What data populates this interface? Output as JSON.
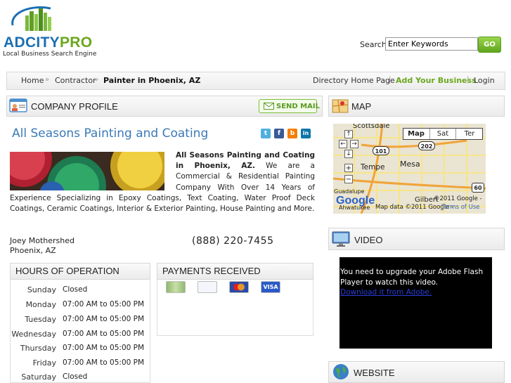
{
  "header": {
    "logo_text": "ADCITYPRO",
    "logo_tagline": "Local Business Search Engine",
    "search_label": "Search",
    "search_placeholder": "Enter Keywords",
    "search_value": "Enter Keywords",
    "go_label": "GO"
  },
  "breadcrumb": {
    "home": "Home",
    "sep": "»",
    "contractor": "Contractor",
    "current": "Painter in Phoenix, AZ",
    "directory_home": "Directory Home Page",
    "add_business": "Add Your Business",
    "login": "Login",
    "pipe": "|"
  },
  "profile": {
    "title": "COMPANY PROFILE",
    "send_mail": "SEND MAIL",
    "business_name": "All Seasons Painting and Coating",
    "social": [
      "t",
      "f",
      "b",
      "in"
    ],
    "desc_bold": "All Seasons Painting and Coating in Phoenix, AZ.",
    "desc_rest": " We are a Commercial & Residential Painting Company With Over 14 Years of Experience Specializing in Epoxy Coatings, Text Coating, Water Proof Deck Coatings, Ceramic Coatings, Interior & Exterior Painting, House Painting and More.",
    "contact_name": "Joey Mothershed",
    "contact_city": "Phoenix, AZ",
    "phone": "(888) 220-7455"
  },
  "hours": {
    "title": "HOURS OF OPERATION",
    "days": [
      {
        "day": "Sunday",
        "time": "Closed"
      },
      {
        "day": "Monday",
        "time": "07:00 AM to 05:00 PM"
      },
      {
        "day": "Tuesday",
        "time": "07:00 AM to 05:00 PM"
      },
      {
        "day": "Wednesday",
        "time": "07:00 AM to 05:00 PM"
      },
      {
        "day": "Thursday",
        "time": "07:00 AM to 05:00 PM"
      },
      {
        "day": "Friday",
        "time": "07:00 AM to 05:00 PM"
      },
      {
        "day": "Saturday",
        "time": "Closed"
      }
    ]
  },
  "payments": {
    "title": "PAYMENTS RECEIVED",
    "cards": [
      "cash-icon",
      "check-icon",
      "mastercard-icon",
      "visa-icon"
    ],
    "visa_label": "VISA"
  },
  "map": {
    "title": "MAP",
    "types": [
      "Map",
      "Sat",
      "Ter"
    ],
    "labels": {
      "scottsdale": "Scottsdale",
      "tempe": "Tempe",
      "mesa": "Mesa",
      "gilbert": "Gilbert",
      "guadalupe": "Guadalupe",
      "ahwatukee": "Ahwatukee",
      "r101": "101",
      "r202": "202",
      "r60": "60"
    },
    "copyright1": "©2011 Google -",
    "copyright2": "Map data ©2011 Google -",
    "terms": "Terms of Use",
    "google": "Google"
  },
  "video": {
    "title": "VIDEO",
    "message": "You need to upgrade your Adobe Flash Player to watch this video.",
    "link": "Download it from Adobe."
  },
  "website": {
    "title": "WEBSITE"
  },
  "colors": {
    "brand_green": "#6aa81e",
    "title_blue": "#3b79b8",
    "logo_blue": "#1b6fb3"
  }
}
